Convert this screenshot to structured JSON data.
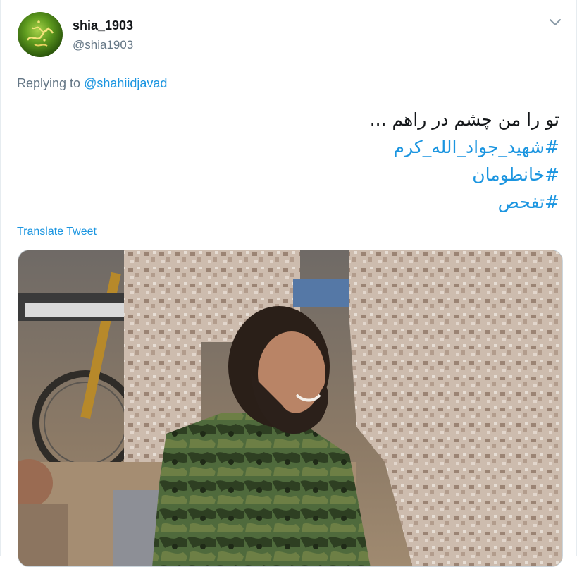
{
  "tweet": {
    "display_name": "shia_1903",
    "handle": "@shia1903",
    "replying_prefix": "Replying to",
    "replying_to": "@shahiidjavad",
    "text_line1": "تو را من چشم در راهم ...",
    "hashtag1": "#شهید_جواد_الله_کرم",
    "hashtag2": "#خانطومان",
    "hashtag3": "#تفحص",
    "translate_label": "Translate Tweet"
  },
  "colors": {
    "link": "#1b95e0",
    "secondary_text": "#657786",
    "primary_text": "#14171a"
  },
  "icons": {
    "menu": "chevron-down-icon",
    "avatar": "avatar-image"
  }
}
